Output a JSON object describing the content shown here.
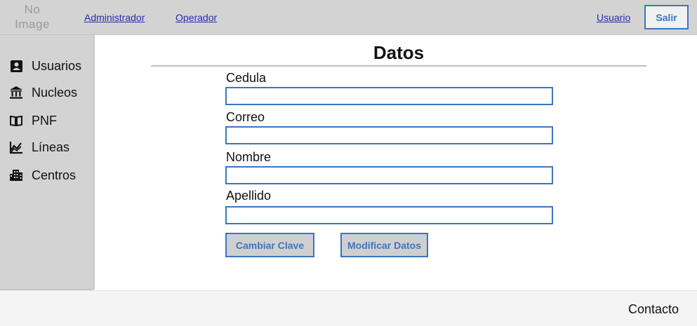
{
  "header": {
    "logo_text": "No Image",
    "nav": {
      "admin": "Administrador",
      "operator": "Operador",
      "user": "Usuario"
    },
    "logout_label": "Salir"
  },
  "sidebar": {
    "items": [
      {
        "label": "Usuarios",
        "icon": "user-card-icon"
      },
      {
        "label": "Nucleos",
        "icon": "bank-icon"
      },
      {
        "label": "PNF",
        "icon": "book-icon"
      },
      {
        "label": "Líneas",
        "icon": "line-chart-icon"
      },
      {
        "label": "Centros",
        "icon": "building-icon"
      }
    ]
  },
  "main": {
    "title": "Datos",
    "fields": [
      {
        "label": "Cedula",
        "value": ""
      },
      {
        "label": "Correo",
        "value": ""
      },
      {
        "label": "Nombre",
        "value": ""
      },
      {
        "label": "Apellido",
        "value": ""
      }
    ],
    "change_password_label": "Cambiar Clave",
    "modify_label": "Modificar Datos"
  },
  "footer": {
    "contact_label": "Contacto"
  },
  "colors": {
    "accent": "#3a76c0",
    "chrome": "#d3d3d3"
  }
}
